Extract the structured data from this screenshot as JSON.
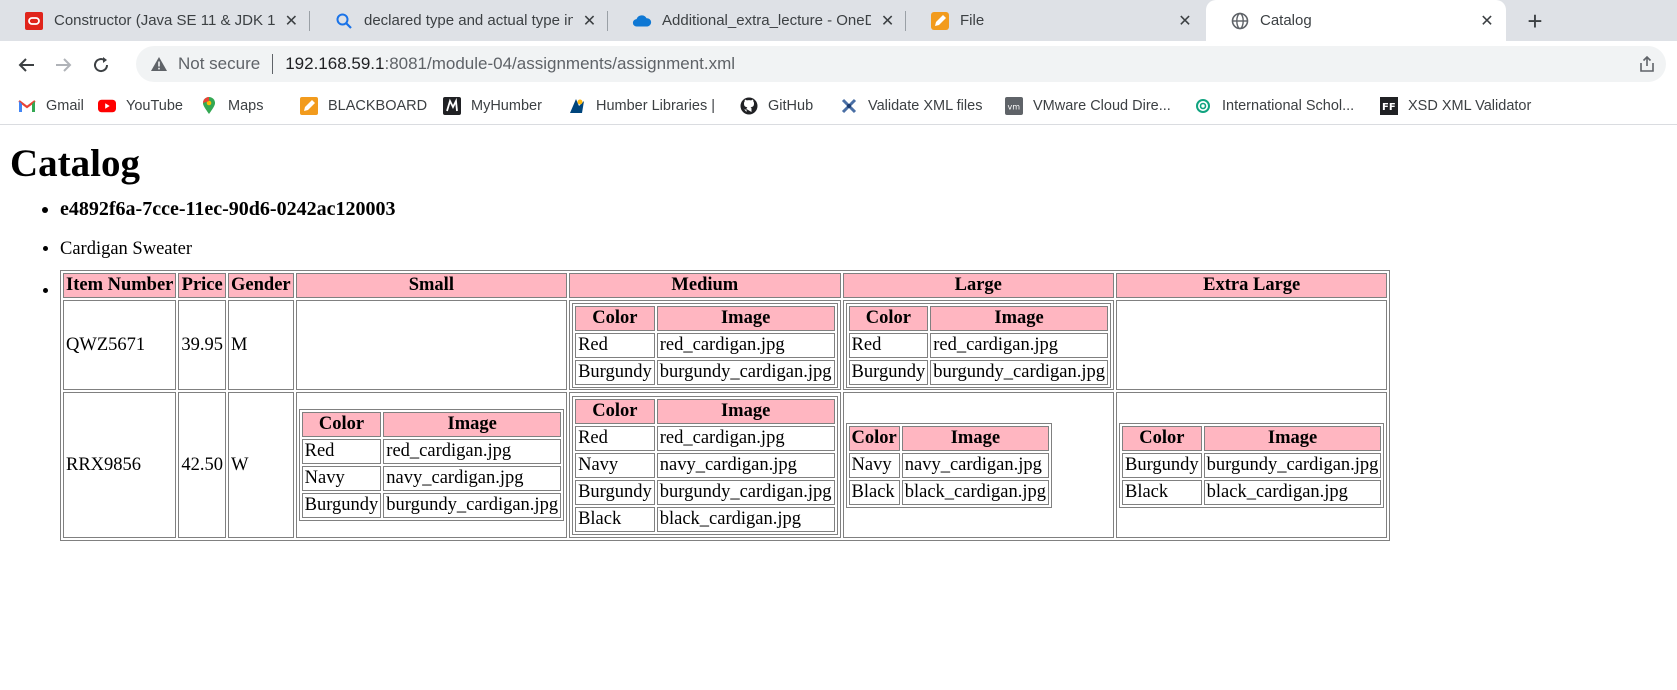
{
  "browser": {
    "tabs": [
      {
        "title": "Constructor (Java SE 11 & JDK 11",
        "icon": "oracle-icon"
      },
      {
        "title": "declared type and actual type in j",
        "icon": "search-icon"
      },
      {
        "title": "Additional_extra_lecture - OneDri",
        "icon": "onedrive-icon"
      },
      {
        "title": "File",
        "icon": "pencil-icon"
      },
      {
        "title": "Catalog",
        "icon": "globe-icon"
      }
    ],
    "new_tab": "+",
    "close_glyph": "✕",
    "security_label": "Not secure",
    "url_host": "192.168.59.1",
    "url_path": ":8081/module-04/assignments/assignment.xml",
    "bookmarks": [
      {
        "label": "Gmail",
        "icon": "gmail-icon"
      },
      {
        "label": "YouTube",
        "icon": "youtube-icon"
      },
      {
        "label": "Maps",
        "icon": "maps-icon"
      },
      {
        "label": "BLACKBOARD",
        "icon": "blackboard-icon"
      },
      {
        "label": "MyHumber",
        "icon": "myhumber-icon"
      },
      {
        "label": "Humber Libraries |",
        "icon": "humber-libraries-icon"
      },
      {
        "label": "GitHub",
        "icon": "github-icon"
      },
      {
        "label": "Validate XML files",
        "icon": "validate-xml-icon"
      },
      {
        "label": "VMware Cloud Dire...",
        "icon": "vmware-icon"
      },
      {
        "label": "International Schol...",
        "icon": "international-scholars-icon"
      },
      {
        "label": "XSD XML Validator",
        "icon": "xsd-validator-icon"
      }
    ],
    "colors": {
      "tabstrip": "#dee1e6",
      "header_pink": "#ffb6c1"
    }
  },
  "page": {
    "heading": "Catalog",
    "product_id": "e4892f6a-7cce-11ec-90d6-0242ac120003",
    "product_name": "Cardigan Sweater",
    "table": {
      "headers": [
        "Item Number",
        "Price",
        "Gender",
        "Small",
        "Medium",
        "Large",
        "Extra Large"
      ],
      "inner_headers": [
        "Color",
        "Image"
      ],
      "rows": [
        {
          "item_number": "QWZ5671",
          "price": "39.95",
          "gender": "M",
          "sizes": [
            [],
            [
              [
                "Red",
                "red_cardigan.jpg"
              ],
              [
                "Burgundy",
                "burgundy_cardigan.jpg"
              ]
            ],
            [
              [
                "Red",
                "red_cardigan.jpg"
              ],
              [
                "Burgundy",
                "burgundy_cardigan.jpg"
              ]
            ],
            []
          ]
        },
        {
          "item_number": "RRX9856",
          "price": "42.50",
          "gender": "W",
          "sizes": [
            [
              [
                "Red",
                "red_cardigan.jpg"
              ],
              [
                "Navy",
                "navy_cardigan.jpg"
              ],
              [
                "Burgundy",
                "burgundy_cardigan.jpg"
              ]
            ],
            [
              [
                "Red",
                "red_cardigan.jpg"
              ],
              [
                "Navy",
                "navy_cardigan.jpg"
              ],
              [
                "Burgundy",
                "burgundy_cardigan.jpg"
              ],
              [
                "Black",
                "black_cardigan.jpg"
              ]
            ],
            [
              [
                "Navy",
                "navy_cardigan.jpg"
              ],
              [
                "Black",
                "black_cardigan.jpg"
              ]
            ],
            [
              [
                "Burgundy",
                "burgundy_cardigan.jpg"
              ],
              [
                "Black",
                "black_cardigan.jpg"
              ]
            ]
          ]
        }
      ]
    }
  }
}
